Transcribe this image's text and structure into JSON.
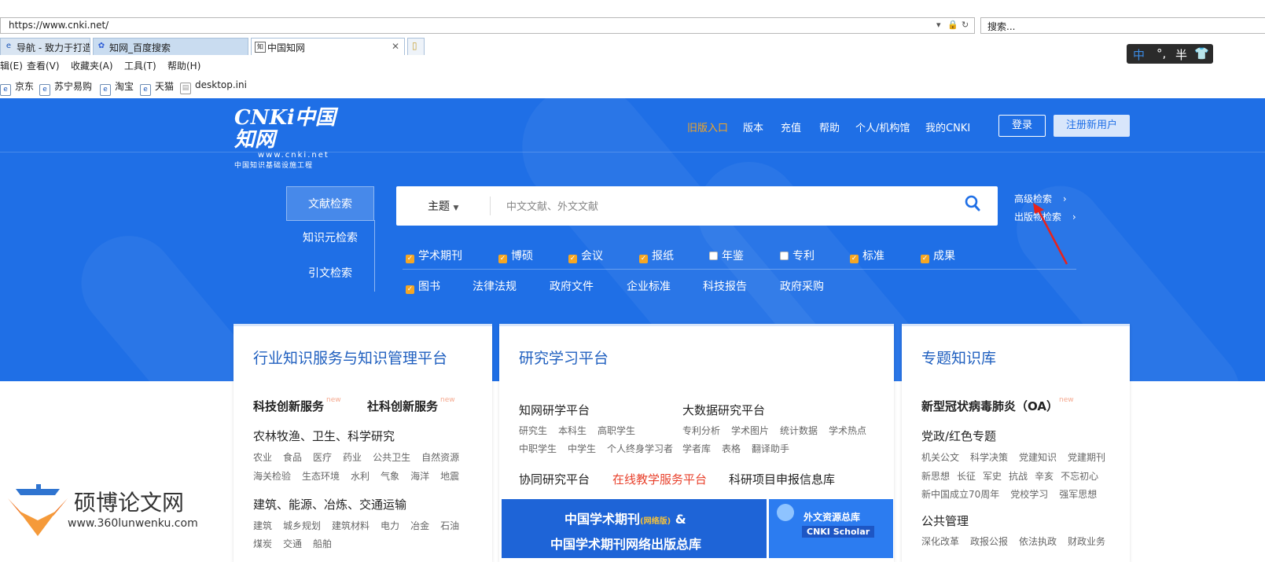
{
  "browser": {
    "url": "https://www.cnki.net/",
    "search_placeholder": "搜索...",
    "tabs": [
      {
        "label": "导航 - 致力于打造百...",
        "icon": "e"
      },
      {
        "label": "知网_百度搜索",
        "icon": "🐾"
      },
      {
        "label": "中国知网",
        "icon": "知"
      }
    ],
    "menu": [
      "辑(E)",
      "查看(V)",
      "收藏夹(A)",
      "工具(T)",
      "帮助(H)"
    ],
    "favorites": [
      "京东",
      "苏宁易购",
      "淘宝",
      "天猫",
      "desktop.ini"
    ],
    "ime": {
      "lang": "中",
      "punct": "°,",
      "width": "半"
    }
  },
  "site": {
    "logo": {
      "brand": "CNKi中国知网",
      "domain": "www.cnki.net",
      "tagline": "中国知识基础设施工程"
    },
    "nav": {
      "old": "旧版入口",
      "edition": "版本",
      "recharge": "充值",
      "help": "帮助",
      "personal": "个人/机构馆",
      "mine": "我的CNKI"
    },
    "login": "登录",
    "register": "注册新用户",
    "search_tabs": [
      "文献检索",
      "知识元检索",
      "引文检索"
    ],
    "search": {
      "field": "主题",
      "placeholder": "中文文献、外文文献"
    },
    "advanced": "高级检索",
    "publisher": "出版物检索",
    "filters_row1": [
      {
        "label": "学术期刊",
        "checked": true
      },
      {
        "label": "博硕",
        "checked": true
      },
      {
        "label": "会议",
        "checked": true
      },
      {
        "label": "报纸",
        "checked": true
      },
      {
        "label": "年鉴",
        "checked": false
      },
      {
        "label": "专利",
        "checked": false
      },
      {
        "label": "标准",
        "checked": true
      },
      {
        "label": "成果",
        "checked": true
      }
    ],
    "filters_row2": {
      "book": "图书",
      "items": [
        "法律法规",
        "政府文件",
        "企业标准",
        "科技报告",
        "政府采购"
      ]
    }
  },
  "cards": {
    "industry": {
      "title": "行业知识服务与知识管理平台",
      "tech": "科技创新服务",
      "social": "社科创新服务",
      "new": "new",
      "sec1": "农林牧渔、卫生、科学研究",
      "sec1_row1": [
        "农业",
        "食品",
        "医疗",
        "药业",
        "公共卫生",
        "自然资源"
      ],
      "sec1_row2": [
        "海关检验",
        "生态环境",
        "水利",
        "气象",
        "海洋",
        "地震"
      ],
      "sec2": "建筑、能源、冶炼、交通运输",
      "sec2_row1": [
        "建筑",
        "城乡规划",
        "建筑材料",
        "电力",
        "冶金",
        "石油"
      ],
      "sec2_row2": [
        "煤炭",
        "交通",
        "船舶"
      ]
    },
    "research": {
      "title": "研究学习平台",
      "zhiwang": "知网研学平台",
      "zhiwang_row1": [
        "研究生",
        "本科生",
        "高职学生"
      ],
      "zhiwang_row2": [
        "中职学生",
        "中学生",
        "个人终身学习者"
      ],
      "bigdata": "大数据研究平台",
      "bigdata_row1": [
        "专利分析",
        "学术图片",
        "统计数据",
        "学术热点"
      ],
      "bigdata_row2": [
        "学者库",
        "表格",
        "翻译助手"
      ],
      "collab": "协同研究平台",
      "online": "在线教学服务平台",
      "project": "科研项目申报信息库",
      "banner1_l1": "中国学术期刊",
      "banner1_small": "(网络版)",
      "banner1_amp": "&",
      "banner1_l2": "中国学术期刊网络出版总库",
      "banner2_l1": "外文资源总库",
      "banner2_l2": "CNKI Scholar"
    },
    "special": {
      "title": "专题知识库",
      "covid": "新型冠状病毒肺炎（OA）",
      "new": "new",
      "party": "党政/红色专题",
      "party_row1": [
        "机关公文",
        "科学决策",
        "党建知识",
        "党建期刊"
      ],
      "party_row2": [
        "新思想",
        "长征",
        "军史",
        "抗战",
        "辛亥",
        "不忘初心"
      ],
      "party_row3": [
        "新中国成立70周年",
        "党校学习",
        "强军思想"
      ],
      "public": "公共管理",
      "public_row1": [
        "深化改革",
        "政报公报",
        "依法执政",
        "财政业务"
      ]
    }
  },
  "watermark": {
    "name": "硕博论文网",
    "url": "www.360lunwenku.com"
  },
  "colors": {
    "brand_blue": "#1f6fe6",
    "accent_orange": "#f5a623",
    "red": "#e8412c"
  }
}
